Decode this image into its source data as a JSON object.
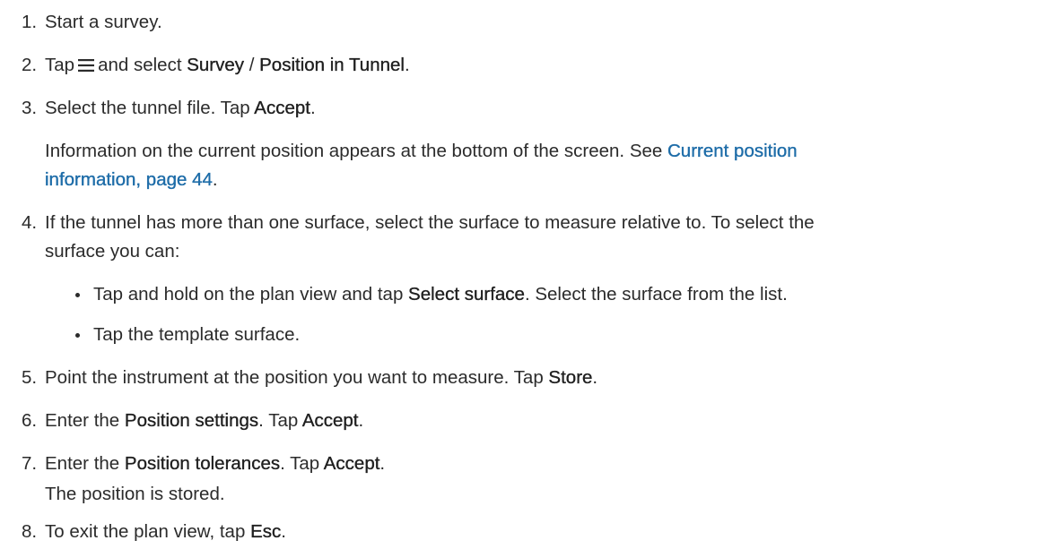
{
  "steps": [
    {
      "number": "1.",
      "parts": [
        "Start a survey."
      ]
    },
    {
      "number": "2.",
      "parts": [
        "Tap",
        "and select",
        "Survey",
        " / ",
        "Position in Tunnel",
        "."
      ]
    },
    {
      "number": "3.",
      "parts": [
        "Select the tunnel file. Tap ",
        "Accept",
        "."
      ],
      "note_line1": "Information on the current position appears at the bottom of the screen. See ",
      "note_link1": "Current position",
      "note_link2": "information, page 44",
      "note_end": "."
    },
    {
      "number": "4.",
      "line1": "If the tunnel has more than one surface, select the surface to measure relative to. To select the",
      "line2": "surface you can:",
      "bullets": [
        {
          "pre": "Tap and hold on the plan view and tap ",
          "bold": "Select surface",
          "post": ". Select the surface from the list."
        },
        {
          "pre": "Tap the template surface.",
          "bold": "",
          "post": ""
        }
      ]
    },
    {
      "number": "5.",
      "parts": [
        "Point the instrument at the position you want to measure. Tap ",
        "Store",
        "."
      ]
    },
    {
      "number": "6.",
      "parts": [
        "Enter the ",
        "Position settings",
        ". Tap ",
        "Accept",
        "."
      ]
    },
    {
      "number": "7.",
      "parts": [
        "Enter the ",
        "Position tolerances",
        ". Tap ",
        "Accept",
        "."
      ],
      "note": "The position is stored."
    },
    {
      "number": "8.",
      "parts": [
        "To exit the plan view, tap ",
        "Esc",
        "."
      ]
    }
  ],
  "icons": {
    "menu": "hamburger-menu-icon"
  },
  "colors": {
    "text": "#2b2b2b",
    "link": "#1d6ca8"
  }
}
